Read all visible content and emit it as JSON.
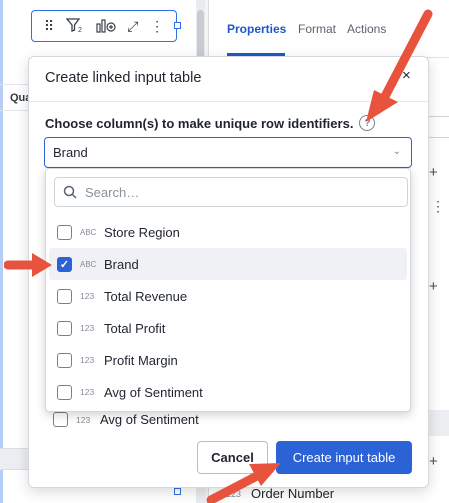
{
  "background": {
    "column_header": "Qua",
    "panel_tabs": [
      "Properties",
      "Format",
      "Actions"
    ],
    "bottom_field": {
      "type_label": "123",
      "label": "Order Number"
    }
  },
  "toolbar": {
    "icons": [
      "drag-handle-icon",
      "filter-icon",
      "chart-add-icon",
      "expand-icon",
      "more-vertical-icon"
    ]
  },
  "modal": {
    "title": "Create linked input table",
    "close_glyph": "×",
    "label": "Choose column(s) to make unique row identifiers.",
    "help_glyph": "?",
    "selected_value": "Brand",
    "chevron_glyph": "⌄",
    "search_placeholder": "Search…",
    "options": [
      {
        "type_label": "ABC",
        "label": "Store Region",
        "checked": false
      },
      {
        "type_label": "ABC",
        "label": "Brand",
        "checked": true
      },
      {
        "type_label": "123",
        "label": "Total Revenue",
        "checked": false
      },
      {
        "type_label": "123",
        "label": "Total Profit",
        "checked": false
      },
      {
        "type_label": "123",
        "label": "Profit Margin",
        "checked": false
      },
      {
        "type_label": "123",
        "label": "Avg of Sentiment",
        "checked": false
      }
    ],
    "underlying_option": {
      "type_label": "123",
      "label": "Avg of Sentiment"
    },
    "cancel_label": "Cancel",
    "create_label": "Create input table"
  },
  "colors": {
    "accent": "#2b62d6",
    "arrow": "#e8533d",
    "tab_active": "#2157c9"
  }
}
